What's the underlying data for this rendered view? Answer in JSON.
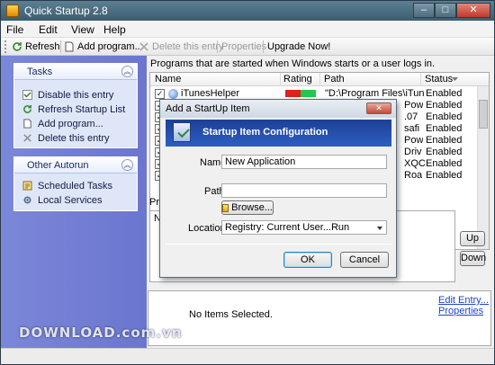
{
  "window": {
    "title": "Quick Startup 2.8",
    "min": "–",
    "max": "□",
    "close": "✕"
  },
  "menu": [
    "File",
    "Edit",
    "View",
    "Help"
  ],
  "toolbar": {
    "refresh": "Refresh",
    "add": "Add program...",
    "delete": "Delete this entry",
    "properties": "Properties",
    "upgrade": "Upgrade Now!"
  },
  "sidebar": {
    "tasks": {
      "title": "Tasks",
      "items": [
        "Disable this entry",
        "Refresh Startup List",
        "Add program...",
        "Delete this entry"
      ]
    },
    "other": {
      "title": "Other Autorun",
      "items": [
        "Scheduled Tasks",
        "Local Services"
      ]
    }
  },
  "main": {
    "heading": "Programs that are started when Windows starts or a user logs in.",
    "columns": [
      "Name",
      "Rating",
      "Path",
      "Status"
    ],
    "rows": [
      {
        "name": "iTunesHelper",
        "path": "\"D:\\Program Files\\iTunes\\iTun",
        "status": "Enabled"
      },
      {
        "name": "",
        "path": "Pow",
        "status": "Enabled"
      },
      {
        "name": "",
        "path": ".07",
        "status": "Enabled"
      },
      {
        "name": "",
        "path": "safi",
        "status": "Enabled"
      },
      {
        "name": "",
        "path": "Pow",
        "status": "Enabled"
      },
      {
        "name": "",
        "path": "Driv",
        "status": "Enabled"
      },
      {
        "name": "",
        "path": "XQC",
        "status": "Enabled"
      },
      {
        "name": "",
        "path": "Roa",
        "status": "Enabled"
      }
    ],
    "props_fragment": "Pro",
    "name_fragment": "Na",
    "up": "Up",
    "down": "Down"
  },
  "details": {
    "no_items": "No Items Selected.",
    "edit_entry": "Edit Entry...",
    "properties": "Properties"
  },
  "watermark": "DOWNLOAD.com.vn",
  "dialog": {
    "title": "Add a StartUp Item",
    "close": "✕",
    "banner": "Startup Item Configuration",
    "name_label": "Name",
    "name_value": "New Application",
    "path_label": "Path",
    "path_value": "",
    "browse": "Browse...",
    "location_label": "Location",
    "location_value": "Registry: Current User...Run",
    "ok": "OK",
    "cancel": "Cancel"
  },
  "colors": {
    "rating_bad": "#e02020",
    "rating_good": "#22c84a",
    "banner": "#2d5fc1",
    "sidebar": "#7b87d8"
  }
}
